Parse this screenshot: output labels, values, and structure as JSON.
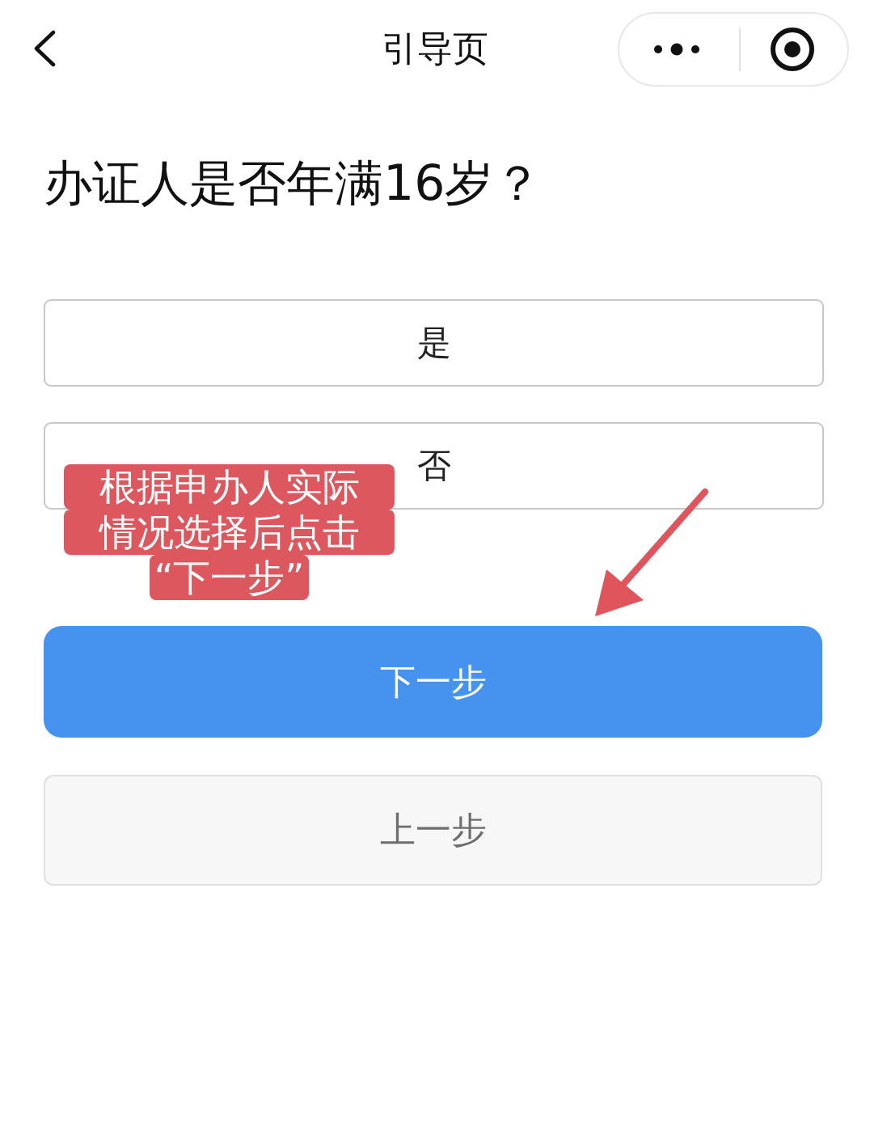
{
  "nav": {
    "title": "引导页"
  },
  "question": "办证人是否年满16岁？",
  "options": [
    {
      "label": "是"
    },
    {
      "label": "否"
    }
  ],
  "buttons": [
    {
      "kind": "primary",
      "label": "下一步"
    },
    {
      "kind": "secondary",
      "label": "上一步"
    }
  ],
  "annotation": {
    "lines": [
      "根据申办人实际",
      "情况选择后点击",
      "“下一步”"
    ]
  }
}
